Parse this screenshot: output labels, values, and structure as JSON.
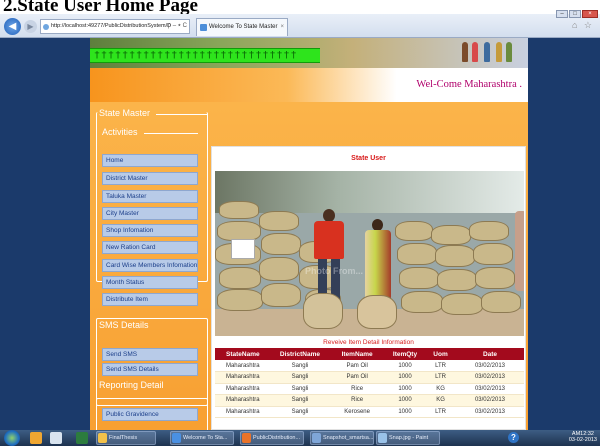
{
  "heading": "2.State User Home Page",
  "browser": {
    "address": "http://localhost:49277/PublicDistributionSystem/D",
    "address_tools": "ρ – ⭑ C",
    "tab_title": "Welcome To State Master",
    "tab_close": "×"
  },
  "site": {
    "welcome": "Wel-Come Maharashtra .",
    "strip_pattern": "†††††††††††††††††††††††††††††"
  },
  "sidebar": {
    "state_master": "State Master",
    "activities": "Activities",
    "activity_items": [
      "Home",
      "District Master",
      "Taluka Master",
      "City Master",
      "Shop Infomation",
      "New Ration Card",
      "Card Wise Members Infomation",
      "Month Status",
      "Distribute Item"
    ],
    "sms_title": "SMS Details",
    "sms_items": [
      "Send SMS",
      "Send SMS Details"
    ],
    "reporting_title": "Reporting Detail",
    "reporting_items": [
      "Public Gravidence"
    ]
  },
  "content": {
    "panel_title": "State User",
    "watermark": "Photo From...",
    "table_caption": "Reveive Item Detail Information",
    "columns": [
      "StateName",
      "DistrictName",
      "ItemName",
      "ItemQty",
      "Uom",
      "Date"
    ],
    "rows": [
      [
        "Maharashtra",
        "Sangli",
        "Pam Oil",
        "1000",
        "LTR",
        "03/02/2013"
      ],
      [
        "Maharashtra",
        "Sangli",
        "Pam Oil",
        "1000",
        "LTR",
        "03/02/2013"
      ],
      [
        "Maharashtra",
        "Sangli",
        "Rice",
        "1000",
        "KG",
        "03/02/2013"
      ],
      [
        "Maharashtra",
        "Sangli",
        "Rice",
        "1000",
        "KG",
        "03/02/2013"
      ],
      [
        "Maharashtra",
        "Sangli",
        "Kerosene",
        "1000",
        "LTR",
        "03/02/2013"
      ]
    ]
  },
  "taskbar": {
    "buttons": [
      "FinalThesis",
      "Welcome To Sta...",
      "PublicDistribution...",
      "Snapshot_smartsa...",
      "Snap.jpg - Paint"
    ],
    "help": "?",
    "time": "AM12:32",
    "date": "03-02-2013"
  },
  "colors": {
    "accent_red": "#a30a1d",
    "menu_blue": "#b8cbe8",
    "green_strip": "#2ee41c",
    "welcome_text": "#b0006b"
  }
}
